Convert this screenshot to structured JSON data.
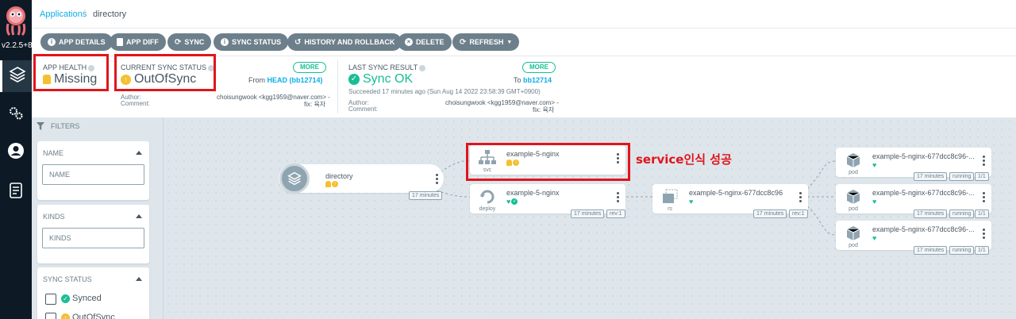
{
  "nav": {
    "version": "v2.2.5+8",
    "items": [
      "applications-icon",
      "settings-icon",
      "user-icon",
      "docs-icon"
    ]
  },
  "breadcrumb": {
    "parent": "Applications",
    "separator": "/",
    "current": "directory"
  },
  "toolbar": {
    "app_details": "APP DETAILS",
    "app_diff": "APP DIFF",
    "sync": "SYNC",
    "sync_status": "SYNC STATUS",
    "history": "HISTORY AND ROLLBACK",
    "delete": "DELETE",
    "refresh": "REFRESH"
  },
  "status": {
    "health_label": "APP HEALTH",
    "health_value": "Missing",
    "sync_label": "CURRENT SYNC STATUS",
    "sync_value": "OutOfSync",
    "more": "MORE",
    "from_prefix": "From",
    "from_value": "HEAD (bb12714)",
    "author_label": "Author:",
    "comment_label": "Comment:",
    "author_value": "choisungwook <kgg1959@naver.com> -",
    "comment_value": "fix: 육자",
    "last_label": "LAST SYNC RESULT",
    "last_value": "Sync OK",
    "to_prefix": "To",
    "to_value": "bb12714",
    "succeeded": "Succeeded 17 minutes ago (Sun Aug 14 2022 23:58:39 GMT+0900)"
  },
  "filters": {
    "title": "FILTERS",
    "name_title": "NAME",
    "name_placeholder": "NAME",
    "kinds_title": "KINDS",
    "kinds_placeholder": "KINDS",
    "sync_title": "SYNC STATUS",
    "synced": "Synced",
    "outofsync": "OutOfSync"
  },
  "graph": {
    "app": {
      "name": "directory",
      "age": "17 minutes"
    },
    "svc": {
      "name": "example-5-nginx",
      "kind": "svc"
    },
    "deploy": {
      "name": "example-5-nginx",
      "kind": "deploy",
      "age": "17 minutes",
      "rev": "rev:1"
    },
    "rs": {
      "name": "example-5-nginx-677dcc8c96",
      "kind": "rs",
      "age": "17 minutes",
      "rev": "rev:1"
    },
    "pods": [
      {
        "name": "example-5-nginx-677dcc8c96-...",
        "kind": "pod",
        "age": "17 minutes",
        "state": "running",
        "ready": "1/1"
      },
      {
        "name": "example-5-nginx-677dcc8c96-...",
        "kind": "pod",
        "age": "17 minutes",
        "state": "running",
        "ready": "1/1"
      },
      {
        "name": "example-5-nginx-677dcc8c96-...",
        "kind": "pod",
        "age": "17 minutes",
        "state": "running",
        "ready": "1/1"
      }
    ],
    "annotation": "service인식 성공"
  },
  "colors": {
    "healthy": "#18be94",
    "warning": "#f4c030",
    "link": "#0dadea",
    "highlight": "#e0151b",
    "nav_bg": "#0d1a26"
  }
}
